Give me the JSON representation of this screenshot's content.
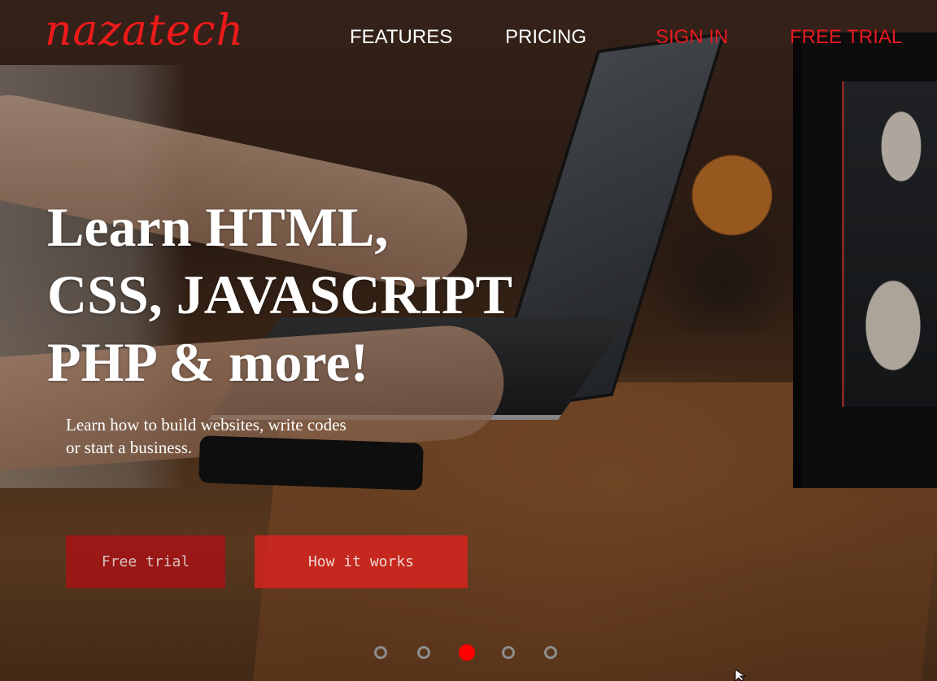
{
  "brand": {
    "logo_text": "nazatech",
    "accent_color": "#ee1a1a"
  },
  "nav": {
    "features": "FEATURES",
    "pricing": "PRICING",
    "sign_in": "SIGN IN",
    "free_trial": "FREE TRIAL"
  },
  "hero": {
    "headline_line1": "Learn HTML,",
    "headline_line2": "CSS, JAVASCRIPT",
    "headline_line3": "PHP & more!",
    "subtext": "Learn how to build websites, write codes or start a business."
  },
  "buttons": {
    "free_trial": "Free trial",
    "how_it_works": "How it works"
  },
  "carousel": {
    "slide_count": 5,
    "active_index": 2
  },
  "icons": {
    "cursor": "mouse-pointer-icon"
  }
}
